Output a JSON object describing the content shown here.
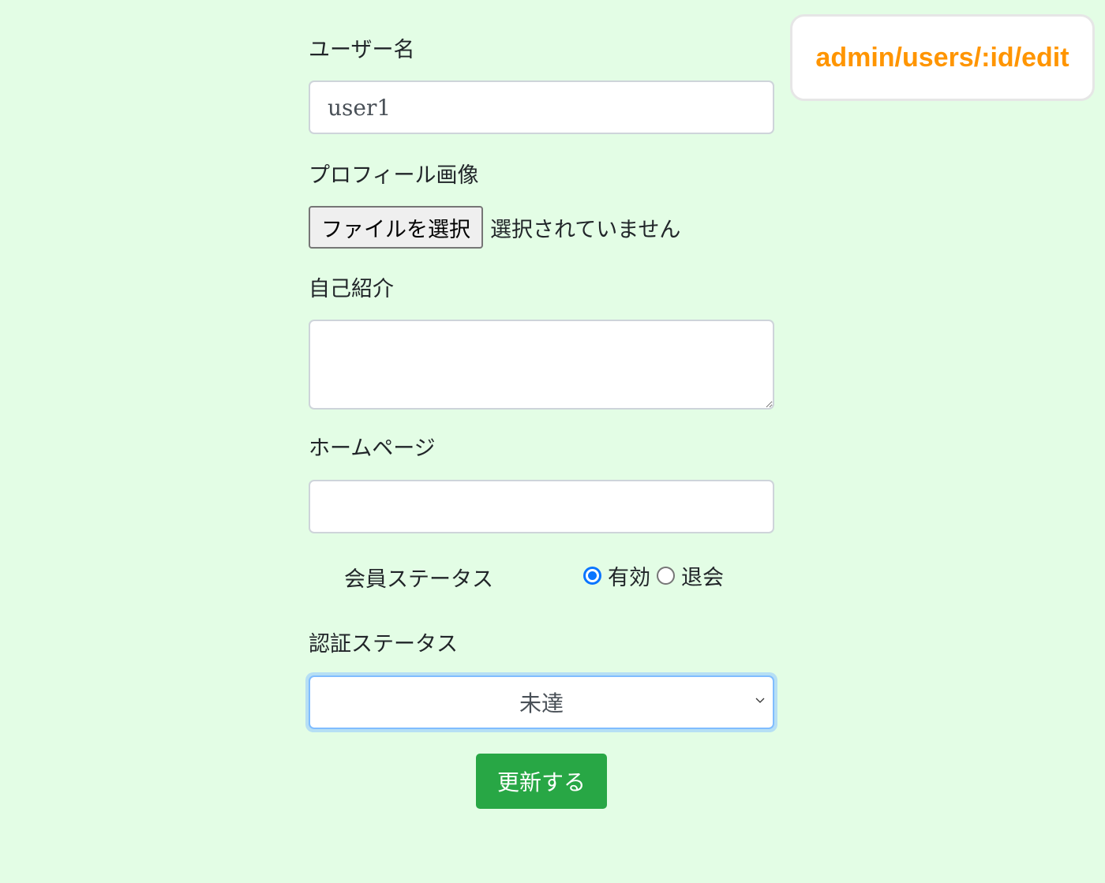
{
  "route_badge": "admin/users/:id/edit",
  "form": {
    "username": {
      "label": "ユーザー名",
      "value": "user1"
    },
    "profile_image": {
      "label": "プロフィール画像",
      "button_label": "ファイルを選択",
      "status": "選択されていません"
    },
    "introduction": {
      "label": "自己紹介",
      "value": ""
    },
    "homepage": {
      "label": "ホームページ",
      "value": ""
    },
    "member_status": {
      "label": "会員ステータス",
      "options": [
        {
          "label": "有効",
          "checked": true
        },
        {
          "label": "退会",
          "checked": false
        }
      ]
    },
    "auth_status": {
      "label": "認証ステータス",
      "selected": "未達",
      "icon": "chevron-down-icon"
    },
    "submit_label": "更新する"
  },
  "colors": {
    "background": "#e3fde5",
    "badge_text": "#ff9500",
    "submit": "#28a745",
    "radio_accent": "#0a75ff",
    "focus_ring": "#b6dff4"
  }
}
